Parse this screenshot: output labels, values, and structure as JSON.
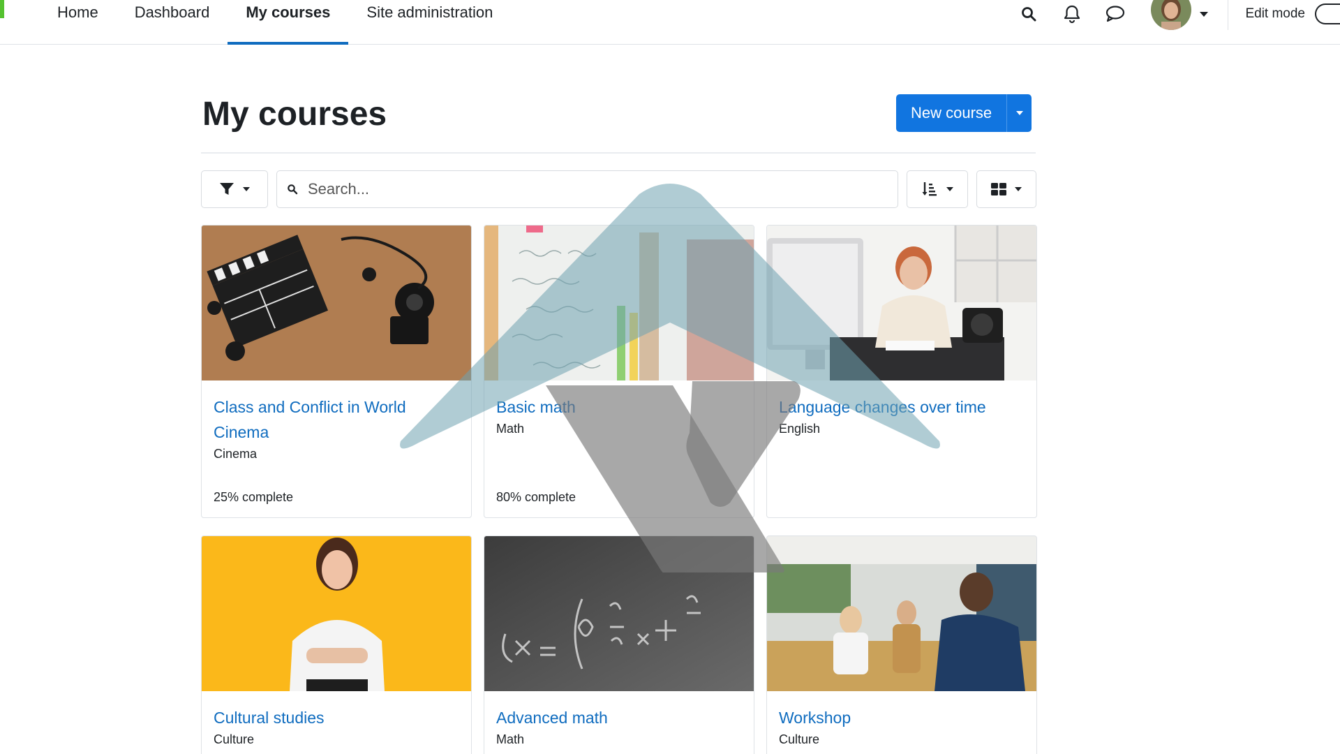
{
  "nav": {
    "items": [
      {
        "label": "Home",
        "active": false
      },
      {
        "label": "Dashboard",
        "active": false
      },
      {
        "label": "My courses",
        "active": true
      },
      {
        "label": "Site administration",
        "active": false
      }
    ],
    "edit_mode_label": "Edit mode"
  },
  "icons": {
    "search": "search-icon",
    "notifications": "bell-icon",
    "messages": "chat-bubble-icon",
    "filter": "filter-icon",
    "sort": "sort-icon",
    "view": "grid-view-icon"
  },
  "page": {
    "title": "My courses",
    "new_course_label": "New course",
    "search_placeholder": "Search..."
  },
  "courses": [
    {
      "title": "Class and Conflict in World Cinema",
      "category": "Cinema",
      "progress": "25% complete"
    },
    {
      "title": "Basic math",
      "category": "Math",
      "progress": "80% complete"
    },
    {
      "title": "Language changes over time",
      "category": "English",
      "progress": ""
    },
    {
      "title": "Cultural studies",
      "category": "Culture",
      "progress": ""
    },
    {
      "title": "Advanced math",
      "category": "Math",
      "progress": ""
    },
    {
      "title": "Workshop",
      "category": "Culture",
      "progress": ""
    }
  ],
  "colors": {
    "accent": "#0f6cbf",
    "button": "#1175e0",
    "brand_strip": "#55c230",
    "watermark_teal": "#6fa3b0",
    "watermark_gray": "#7a7a7a"
  }
}
